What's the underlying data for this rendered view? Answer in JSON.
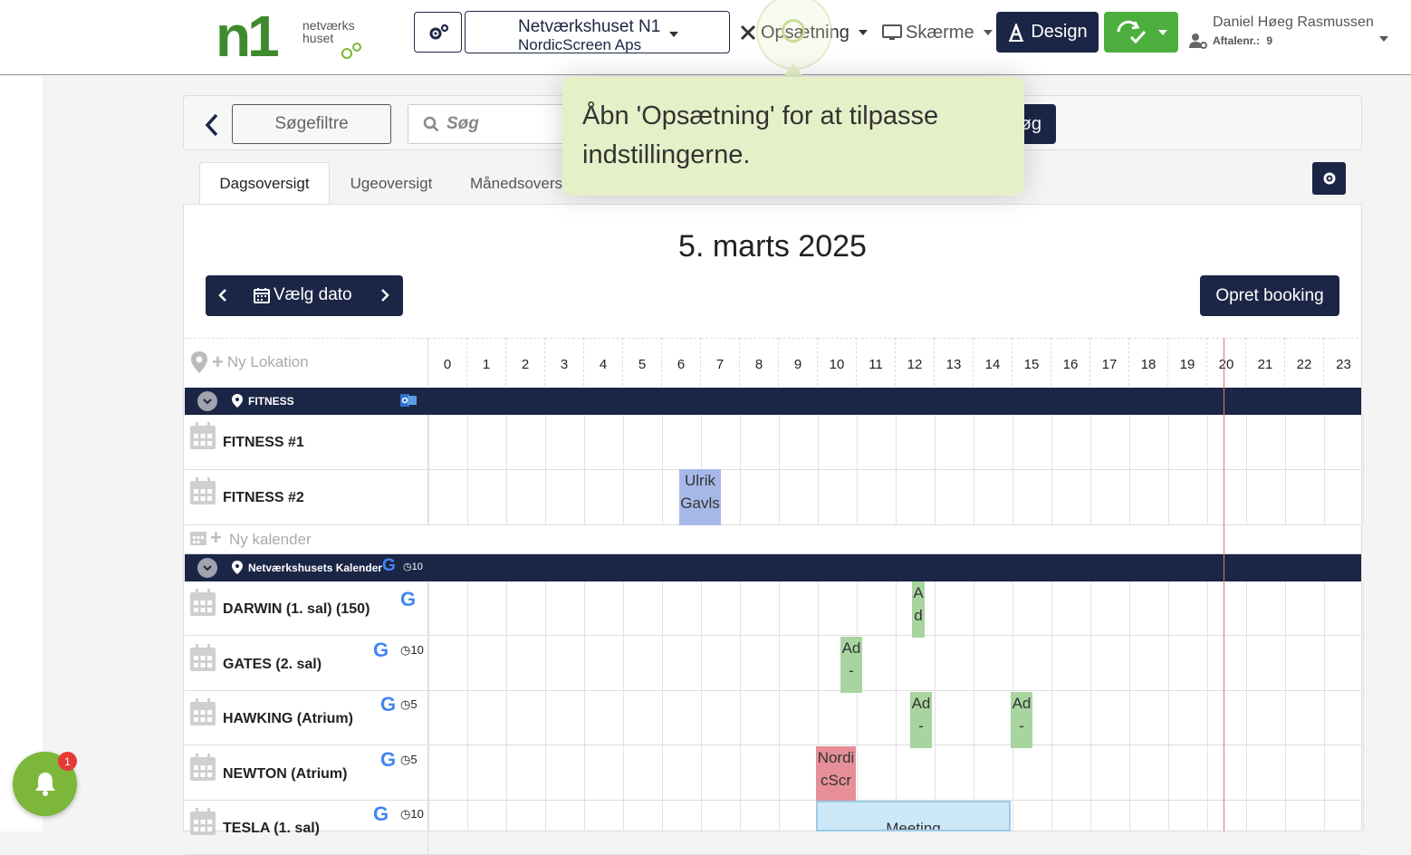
{
  "header": {
    "logo_text_line1": "netværks",
    "logo_text_line2": "huset",
    "logo_mark": "n1",
    "org_line1": "Netværkshuset N1",
    "org_line2": "NordicScreen Aps",
    "nav_setup": "Opsætning",
    "nav_screens": "Skærme",
    "design_label": "Design",
    "user_name": "Daniel Høeg Rasmussen",
    "user_sub_label": "Aftalenr.:",
    "user_sub_value": "9"
  },
  "search": {
    "filters_label": "Søgefiltre",
    "placeholder": "Søg",
    "search_button": "øg"
  },
  "tabs": [
    {
      "label": "Dagsoversigt",
      "active": true
    },
    {
      "label": "Ugeoversigt",
      "active": false
    },
    {
      "label": "Månedsovers",
      "active": false
    }
  ],
  "tooltip": {
    "text": "Åbn 'Opsætning' for at tilpasse indstillingerne."
  },
  "calendar": {
    "date_title": "5. marts 2025",
    "choose_date": "Vælg dato",
    "create_booking": "Opret booking",
    "new_location": "Ny Lokation",
    "new_calendar": "Ny kalender",
    "hours": [
      "0",
      "1",
      "2",
      "3",
      "4",
      "5",
      "6",
      "7",
      "8",
      "9",
      "10",
      "11",
      "12",
      "13",
      "14",
      "15",
      "16",
      "17",
      "18",
      "19",
      "20",
      "21",
      "22",
      "23"
    ],
    "now_hour": 20,
    "locations": [
      {
        "name": "FITNESS",
        "rooms": [
          {
            "name": "FITNESS #1",
            "badges": ""
          },
          {
            "name": "FITNESS #2",
            "badges": ""
          }
        ]
      },
      {
        "name": "Netværkshusets Kalender",
        "clock": "10",
        "rooms": [
          {
            "name": "DARWIN (1. sal) (150)",
            "clock": ""
          },
          {
            "name": "GATES (2. sal)",
            "clock": "10"
          },
          {
            "name": "HAWKING (Atrium)",
            "clock": "5"
          },
          {
            "name": "NEWTON (Atrium)",
            "clock": "5"
          },
          {
            "name": "TESLA (1. sal)",
            "clock": "10"
          }
        ]
      }
    ],
    "bookings": [
      {
        "room": "FITNESS #2",
        "text": "Ulrik Gavls",
        "color": "blue"
      },
      {
        "room": "DARWIN",
        "text": "A d",
        "color": "green"
      },
      {
        "room": "GATES",
        "text": "Ad -",
        "color": "green"
      },
      {
        "room": "HAWKING",
        "text": "Ad -",
        "color": "green"
      },
      {
        "room": "HAWKING",
        "text": "Ad -",
        "color": "green"
      },
      {
        "room": "NEWTON",
        "text": "NordicScr",
        "color": "red"
      },
      {
        "room": "TESLA",
        "text": "Meeting",
        "color": "light"
      }
    ]
  },
  "notification": {
    "count": "1"
  }
}
